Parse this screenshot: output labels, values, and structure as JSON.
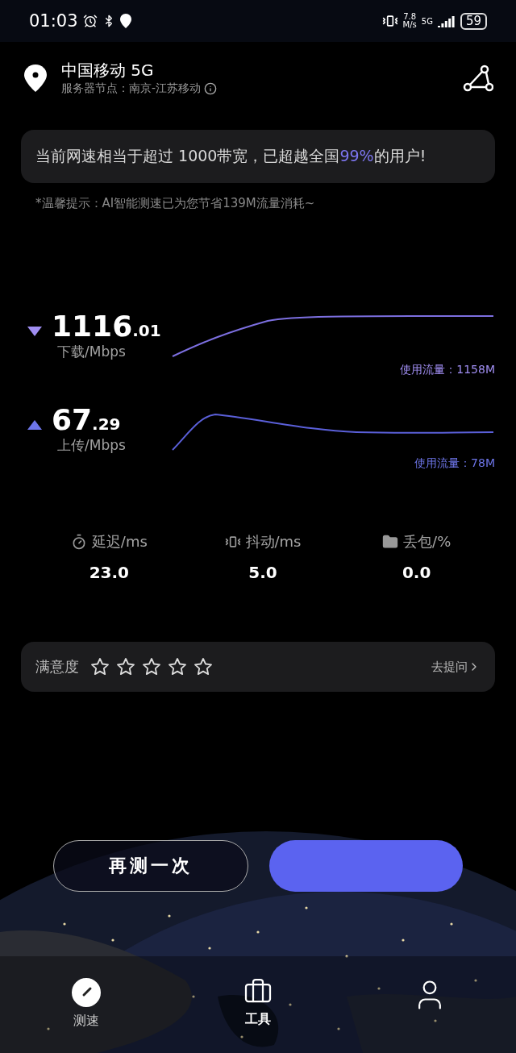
{
  "status_bar": {
    "time": "01:03",
    "net_speed_value": "7.8",
    "net_speed_unit": "M/s",
    "network": "5G",
    "battery": "59"
  },
  "header": {
    "carrier": "中国移动 5G",
    "server_label": "服务器节点：南京-江苏移动"
  },
  "banner": {
    "text": "当前网速相当于超过 1000带宽，已超越全国**99%**的用户!"
  },
  "tip": "*温馨提示：AI智能测速已为您节省139M流量消耗~",
  "speeds": [
    {
      "kind": "down",
      "value_int": "1116",
      "value_dec": ".01",
      "unit": "下载/Mbps",
      "usage": "使用流量：1158M",
      "color": "#a08ef2"
    },
    {
      "kind": "up",
      "value_int": "67",
      "value_dec": ".29",
      "unit": "上传/Mbps",
      "usage": "使用流量：78M",
      "color": "#6e76ea"
    }
  ],
  "metrics": [
    {
      "kind": "latency",
      "label": "延迟/ms",
      "value": "23.0"
    },
    {
      "kind": "jitter",
      "label": "抖动/ms",
      "value": "5.0"
    },
    {
      "kind": "loss",
      "label": "丢包/%",
      "value": "0.0"
    }
  ],
  "satisfaction": {
    "label": "满意度",
    "stars": 0,
    "link": "去提问"
  },
  "buttons": [
    {
      "kind": "outline",
      "label": "再测一次"
    },
    {
      "kind": "primary"
    }
  ],
  "nav": [
    {
      "kind": "speed",
      "label": "测速",
      "selected": true
    },
    {
      "kind": "tools",
      "label": "工具",
      "selected": false
    },
    {
      "kind": "profile",
      "selected": false
    }
  ]
}
